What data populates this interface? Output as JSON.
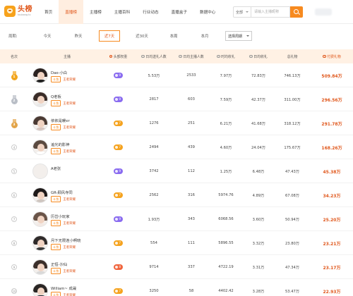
{
  "logo": {
    "text": "头榜",
    "subtext": "toubang.tv"
  },
  "nav": [
    {
      "label": "首页",
      "active": false
    },
    {
      "label": "直播榜",
      "active": true
    },
    {
      "label": "主播榜",
      "active": false
    },
    {
      "label": "主播百科",
      "active": false
    },
    {
      "label": "行业动态",
      "active": false
    },
    {
      "label": "直播盒子",
      "active": false
    },
    {
      "label": "数据中心",
      "active": false
    }
  ],
  "search": {
    "scope": "全部",
    "placeholder": "请输入主播昵称"
  },
  "filter": {
    "label": "周期:",
    "tabs": [
      "今天",
      "昨天",
      "近7天",
      "近30天",
      "本周",
      "本月"
    ],
    "active_tab": "近7天",
    "date_select": "选择周期"
  },
  "table": {
    "headers": [
      "名次",
      "主播",
      "头部权重",
      "日均送礼人数",
      "日均主播人数",
      "时均收礼",
      "日均收礼",
      "总礼物",
      "付费礼物"
    ],
    "rows": [
      {
        "rank": "1",
        "name": "Dae-小白",
        "tag": "斗鱼",
        "sub": "王者荣耀",
        "weight": "9",
        "a": "5.53万",
        "b": "2533",
        "c": "7.97万",
        "d": "72.83万",
        "e": "746.13万",
        "gift": "509.84万",
        "badge": "purple"
      },
      {
        "rank": "2",
        "name": "Q老板",
        "tag": "斗鱼",
        "sub": "王者荣耀",
        "weight": "9",
        "a": "2817",
        "b": "603",
        "c": "7.59万",
        "d": "42.37万",
        "e": "311.00万",
        "gift": "296.56万",
        "badge": "purple"
      },
      {
        "rank": "3",
        "name": "依依是暖er",
        "tag": "斗鱼",
        "sub": "王者荣耀",
        "weight": "7",
        "a": "1276",
        "b": "251",
        "c": "6.21万",
        "d": "41.68万",
        "e": "318.12万",
        "gift": "291.78万",
        "badge": "orange"
      },
      {
        "rank": "4",
        "name": "追光的影神",
        "tag": "斗鱼",
        "sub": "王者荣耀",
        "weight": "7",
        "a": "2494",
        "b": "439",
        "c": "4.60万",
        "d": "24.04万",
        "e": "175.67万",
        "gift": "168.26万",
        "badge": "orange"
      },
      {
        "rank": "5",
        "name": "A老张",
        "tag": "",
        "sub": "",
        "weight": "9",
        "a": "3742",
        "b": "112",
        "c": "1.25万",
        "d": "6.48万",
        "e": "47.43万",
        "gift": "45.38万",
        "badge": "purple"
      },
      {
        "rank": "6",
        "name": "GR-顾风寺同",
        "tag": "斗鱼",
        "sub": "王者荣耀",
        "weight": "7",
        "a": "2562",
        "b": "316",
        "c": "5974.76",
        "d": "4.89万",
        "e": "67.08万",
        "gift": "34.23万",
        "badge": "orange"
      },
      {
        "rank": "7",
        "name": "历岱小玩家",
        "tag": "斗鱼",
        "sub": "王者荣耀",
        "weight": "9",
        "a": "1.93万",
        "b": "343",
        "c": "6068.56",
        "d": "3.60万",
        "e": "50.94万",
        "gift": "25.20万",
        "badge": "purple"
      },
      {
        "rank": "8",
        "name": "月下无限连小啊晓",
        "tag": "斗鱼",
        "sub": "王者荣耀",
        "weight": "7",
        "a": "554",
        "b": "111",
        "c": "5896.55",
        "d": "3.32万",
        "e": "23.80万",
        "gift": "23.21万",
        "badge": "orange"
      },
      {
        "rank": "9",
        "name": "正恒-沙仙",
        "tag": "斗鱼",
        "sub": "王者荣耀",
        "weight": "8",
        "a": "9714",
        "b": "337",
        "c": "4722.19",
        "d": "3.31万",
        "e": "47.34万",
        "gift": "23.17万",
        "badge": "red"
      },
      {
        "rank": "10",
        "name": "William~ 成晟",
        "tag": "斗鱼",
        "sub": "王者荣耀",
        "weight": "7",
        "a": "3250",
        "b": "58",
        "c": "4402.42",
        "d": "3.28万",
        "e": "53.47万",
        "gift": "22.93万",
        "badge": "orange"
      }
    ]
  },
  "colors": {
    "accent": "#f78a1f",
    "gift": "#e0571b",
    "purple": "#8a6cf0",
    "orange": "#f5a31f",
    "red": "#f0643c",
    "gold": "#f2a51d",
    "silver": "#b9bec6",
    "bronze": "#e2a449"
  }
}
